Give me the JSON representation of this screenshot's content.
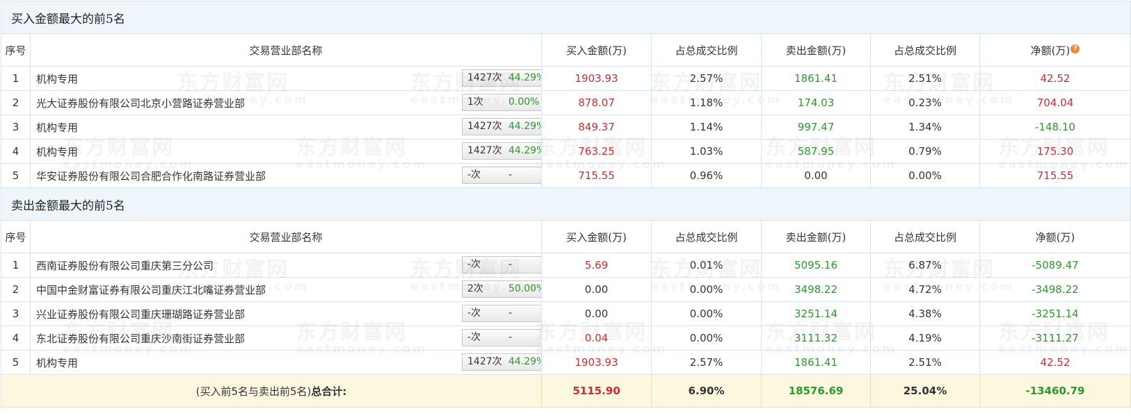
{
  "buy_section": {
    "title": "买入金额最大的前5名",
    "headers": [
      "序号",
      "交易营业部名称",
      "买入金额(万)",
      "占总成交比例",
      "卖出金额(万)",
      "占总成交比例",
      "净额(万)"
    ],
    "net_help_icon": "question-icon",
    "rows": [
      {
        "idx": "1",
        "name": "机构专用",
        "count": "1427次",
        "pct": "44.29%",
        "badge": "question-icon",
        "buy": "1903.93",
        "buy_ratio": "2.57%",
        "sell": "1861.41",
        "sell_ratio": "2.51%",
        "net": "42.52"
      },
      {
        "idx": "2",
        "name": "光大证券股份有限公司北京小营路证券营业部",
        "count": "1次",
        "pct": "0.00%",
        "badge": "arrow-right-icon",
        "buy": "878.07",
        "buy_ratio": "1.18%",
        "sell": "174.03",
        "sell_ratio": "0.23%",
        "net": "704.04"
      },
      {
        "idx": "3",
        "name": "机构专用",
        "count": "1427次",
        "pct": "44.29%",
        "badge": "arrow-right-icon",
        "buy": "849.37",
        "buy_ratio": "1.14%",
        "sell": "997.47",
        "sell_ratio": "1.34%",
        "net": "-148.10"
      },
      {
        "idx": "4",
        "name": "机构专用",
        "count": "1427次",
        "pct": "44.29%",
        "badge": "arrow-right-icon",
        "buy": "763.25",
        "buy_ratio": "1.03%",
        "sell": "587.95",
        "sell_ratio": "0.79%",
        "net": "175.30"
      },
      {
        "idx": "5",
        "name": "华安证券股份有限公司合肥合作化南路证券营业部",
        "count": "-次",
        "pct": "-",
        "badge": "arrow-right-icon",
        "buy": "715.55",
        "buy_ratio": "0.96%",
        "sell": "0.00",
        "sell_ratio": "0.00%",
        "net": "715.55"
      }
    ]
  },
  "sell_section": {
    "title": "卖出金额最大的前5名",
    "headers": [
      "序号",
      "交易营业部名称",
      "买入金额(万)",
      "占总成交比例",
      "卖出金额(万)",
      "占总成交比例",
      "净额(万)"
    ],
    "rows": [
      {
        "idx": "1",
        "name": "西南证券股份有限公司重庆第三分公司",
        "count": "-次",
        "pct": "-",
        "badge": "question-icon",
        "buy": "5.69",
        "buy_ratio": "0.01%",
        "sell": "5095.16",
        "sell_ratio": "6.87%",
        "net": "-5089.47"
      },
      {
        "idx": "2",
        "name": "中国中金财富证券有限公司重庆江北嘴证券营业部",
        "count": "2次",
        "pct": "50.00%",
        "badge": "arrow-right-icon",
        "buy": "0.00",
        "buy_ratio": "0.00%",
        "sell": "3498.22",
        "sell_ratio": "4.72%",
        "net": "-3498.22"
      },
      {
        "idx": "3",
        "name": "兴业证券股份有限公司重庆珊瑚路证券营业部",
        "count": "-次",
        "pct": "-",
        "badge": "arrow-right-icon",
        "buy": "0.00",
        "buy_ratio": "0.00%",
        "sell": "3251.14",
        "sell_ratio": "4.38%",
        "net": "-3251.14"
      },
      {
        "idx": "4",
        "name": "东北证券股份有限公司重庆沙南街证券营业部",
        "count": "-次",
        "pct": "-",
        "badge": "arrow-right-icon",
        "buy": "0.04",
        "buy_ratio": "0.00%",
        "sell": "3111.32",
        "sell_ratio": "4.19%",
        "net": "-3111.27"
      },
      {
        "idx": "5",
        "name": "机构专用",
        "count": "1427次",
        "pct": "44.29%",
        "badge": "arrow-right-icon",
        "buy": "1903.93",
        "buy_ratio": "2.57%",
        "sell": "1861.41",
        "sell_ratio": "2.51%",
        "net": "42.52"
      }
    ]
  },
  "total": {
    "label_prefix": "(买入前5名与卖出前5名)",
    "label_bold": "总合计:",
    "buy": "5115.90",
    "buy_ratio": "6.90%",
    "sell": "18576.69",
    "sell_ratio": "25.04%",
    "net": "-13460.79"
  },
  "watermark": {
    "cn": "东方财富网",
    "en": "eastmoney.com"
  },
  "colors": {
    "positive": "#d12c2c",
    "negative": "#2a9a2a",
    "section_bg": "#eef5fb",
    "total_bg": "#fcf8e0",
    "border": "#d6e4ef"
  }
}
